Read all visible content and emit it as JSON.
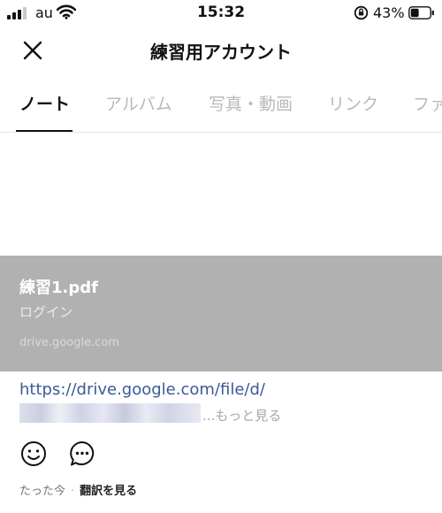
{
  "status_bar": {
    "carrier": "au",
    "time": "15:32",
    "battery_percent": "43%",
    "battery_level": 0.43
  },
  "header": {
    "title": "練習用アカウント",
    "close_icon": "close-icon"
  },
  "tabs": [
    {
      "label": "ノート",
      "active": true
    },
    {
      "label": "アルバム",
      "active": false
    },
    {
      "label": "写真・動画",
      "active": false
    },
    {
      "label": "リンク",
      "active": false
    },
    {
      "label": "ファ",
      "active": false
    }
  ],
  "link_preview": {
    "title": "練習1.pdf",
    "description": "ログイン",
    "domain": "drive.google.com"
  },
  "post": {
    "url": "https://drive.google.com/file/d/",
    "more_label": "...もっと見る"
  },
  "reactions": {
    "smile_icon": "smile-icon",
    "comment_icon": "comment-icon"
  },
  "footer": {
    "timestamp": "たった今",
    "separator": "·",
    "translate_label": "翻訳を見る"
  },
  "colors": {
    "link": "#3b5a97",
    "preview_bg": "#b1b1b1",
    "tab_inactive": "#b9b9b9"
  }
}
